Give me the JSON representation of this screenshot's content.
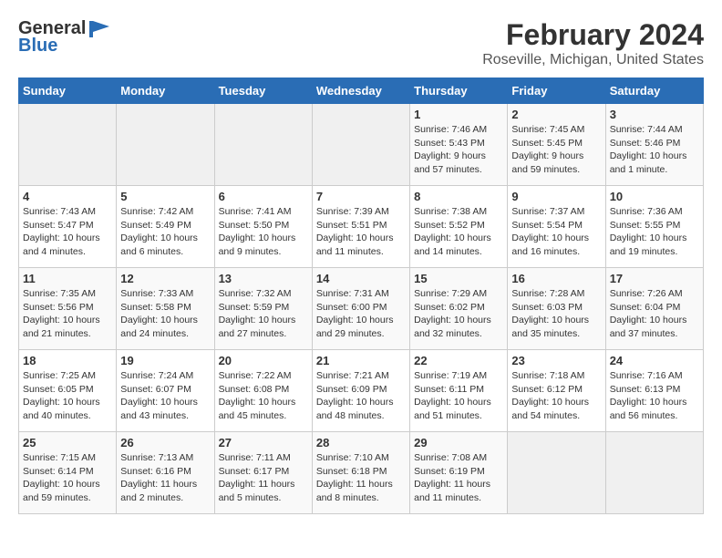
{
  "logo": {
    "general": "General",
    "blue": "Blue"
  },
  "title": "February 2024",
  "subtitle": "Roseville, Michigan, United States",
  "days_of_week": [
    "Sunday",
    "Monday",
    "Tuesday",
    "Wednesday",
    "Thursday",
    "Friday",
    "Saturday"
  ],
  "weeks": [
    [
      {
        "day": "",
        "info": ""
      },
      {
        "day": "",
        "info": ""
      },
      {
        "day": "",
        "info": ""
      },
      {
        "day": "",
        "info": ""
      },
      {
        "day": "1",
        "info": "Sunrise: 7:46 AM\nSunset: 5:43 PM\nDaylight: 9 hours and 57 minutes."
      },
      {
        "day": "2",
        "info": "Sunrise: 7:45 AM\nSunset: 5:45 PM\nDaylight: 9 hours and 59 minutes."
      },
      {
        "day": "3",
        "info": "Sunrise: 7:44 AM\nSunset: 5:46 PM\nDaylight: 10 hours and 1 minute."
      }
    ],
    [
      {
        "day": "4",
        "info": "Sunrise: 7:43 AM\nSunset: 5:47 PM\nDaylight: 10 hours and 4 minutes."
      },
      {
        "day": "5",
        "info": "Sunrise: 7:42 AM\nSunset: 5:49 PM\nDaylight: 10 hours and 6 minutes."
      },
      {
        "day": "6",
        "info": "Sunrise: 7:41 AM\nSunset: 5:50 PM\nDaylight: 10 hours and 9 minutes."
      },
      {
        "day": "7",
        "info": "Sunrise: 7:39 AM\nSunset: 5:51 PM\nDaylight: 10 hours and 11 minutes."
      },
      {
        "day": "8",
        "info": "Sunrise: 7:38 AM\nSunset: 5:52 PM\nDaylight: 10 hours and 14 minutes."
      },
      {
        "day": "9",
        "info": "Sunrise: 7:37 AM\nSunset: 5:54 PM\nDaylight: 10 hours and 16 minutes."
      },
      {
        "day": "10",
        "info": "Sunrise: 7:36 AM\nSunset: 5:55 PM\nDaylight: 10 hours and 19 minutes."
      }
    ],
    [
      {
        "day": "11",
        "info": "Sunrise: 7:35 AM\nSunset: 5:56 PM\nDaylight: 10 hours and 21 minutes."
      },
      {
        "day": "12",
        "info": "Sunrise: 7:33 AM\nSunset: 5:58 PM\nDaylight: 10 hours and 24 minutes."
      },
      {
        "day": "13",
        "info": "Sunrise: 7:32 AM\nSunset: 5:59 PM\nDaylight: 10 hours and 27 minutes."
      },
      {
        "day": "14",
        "info": "Sunrise: 7:31 AM\nSunset: 6:00 PM\nDaylight: 10 hours and 29 minutes."
      },
      {
        "day": "15",
        "info": "Sunrise: 7:29 AM\nSunset: 6:02 PM\nDaylight: 10 hours and 32 minutes."
      },
      {
        "day": "16",
        "info": "Sunrise: 7:28 AM\nSunset: 6:03 PM\nDaylight: 10 hours and 35 minutes."
      },
      {
        "day": "17",
        "info": "Sunrise: 7:26 AM\nSunset: 6:04 PM\nDaylight: 10 hours and 37 minutes."
      }
    ],
    [
      {
        "day": "18",
        "info": "Sunrise: 7:25 AM\nSunset: 6:05 PM\nDaylight: 10 hours and 40 minutes."
      },
      {
        "day": "19",
        "info": "Sunrise: 7:24 AM\nSunset: 6:07 PM\nDaylight: 10 hours and 43 minutes."
      },
      {
        "day": "20",
        "info": "Sunrise: 7:22 AM\nSunset: 6:08 PM\nDaylight: 10 hours and 45 minutes."
      },
      {
        "day": "21",
        "info": "Sunrise: 7:21 AM\nSunset: 6:09 PM\nDaylight: 10 hours and 48 minutes."
      },
      {
        "day": "22",
        "info": "Sunrise: 7:19 AM\nSunset: 6:11 PM\nDaylight: 10 hours and 51 minutes."
      },
      {
        "day": "23",
        "info": "Sunrise: 7:18 AM\nSunset: 6:12 PM\nDaylight: 10 hours and 54 minutes."
      },
      {
        "day": "24",
        "info": "Sunrise: 7:16 AM\nSunset: 6:13 PM\nDaylight: 10 hours and 56 minutes."
      }
    ],
    [
      {
        "day": "25",
        "info": "Sunrise: 7:15 AM\nSunset: 6:14 PM\nDaylight: 10 hours and 59 minutes."
      },
      {
        "day": "26",
        "info": "Sunrise: 7:13 AM\nSunset: 6:16 PM\nDaylight: 11 hours and 2 minutes."
      },
      {
        "day": "27",
        "info": "Sunrise: 7:11 AM\nSunset: 6:17 PM\nDaylight: 11 hours and 5 minutes."
      },
      {
        "day": "28",
        "info": "Sunrise: 7:10 AM\nSunset: 6:18 PM\nDaylight: 11 hours and 8 minutes."
      },
      {
        "day": "29",
        "info": "Sunrise: 7:08 AM\nSunset: 6:19 PM\nDaylight: 11 hours and 11 minutes."
      },
      {
        "day": "",
        "info": ""
      },
      {
        "day": "",
        "info": ""
      }
    ]
  ]
}
